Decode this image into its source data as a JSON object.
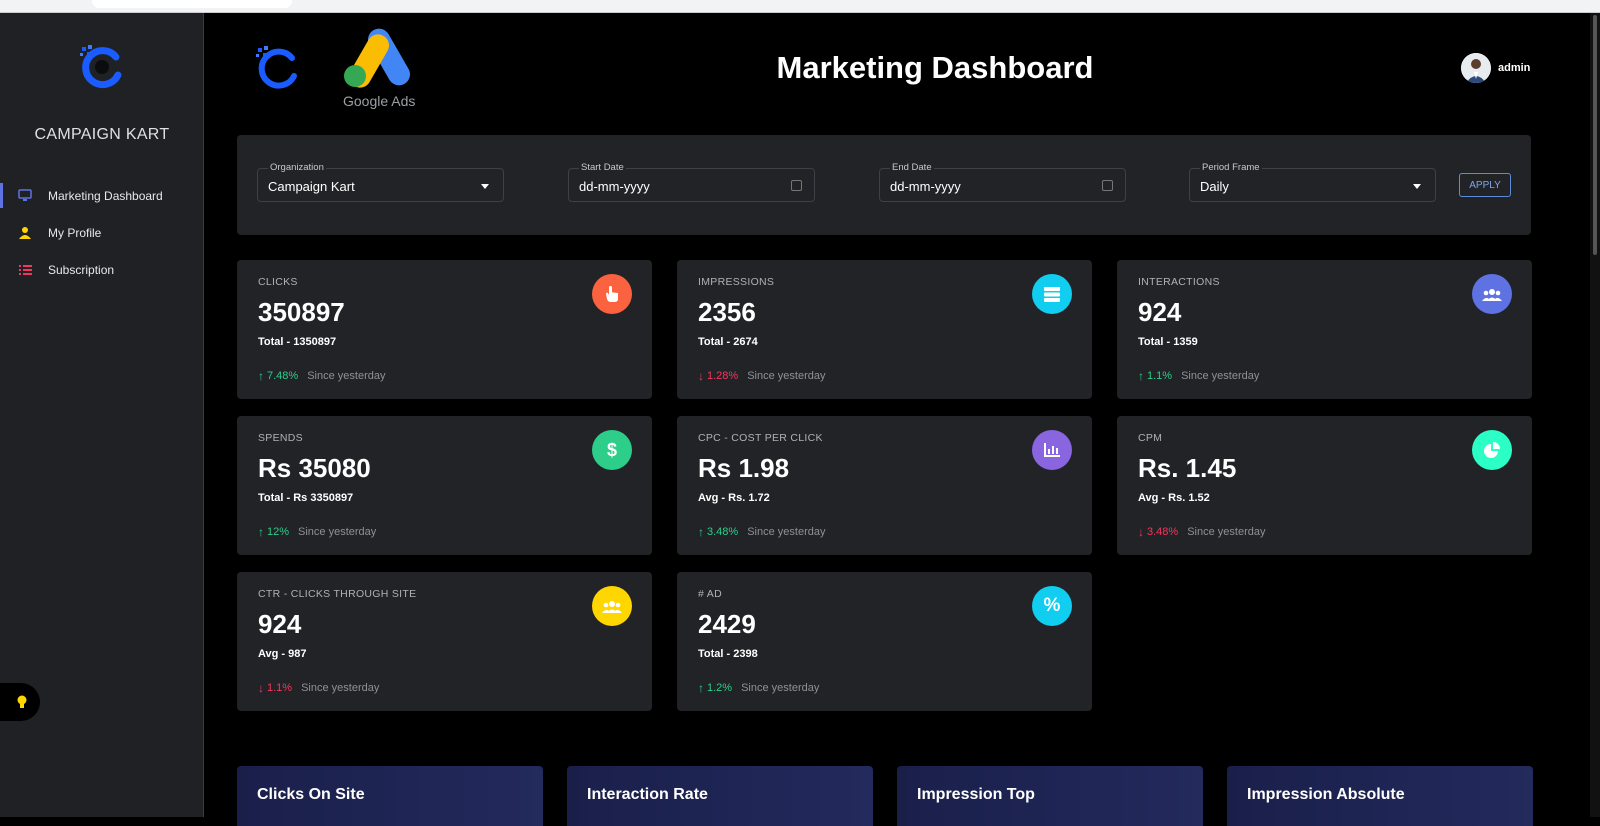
{
  "sidebar": {
    "brand": "CAMPAIGN KART",
    "items": [
      {
        "label": "Marketing Dashboard",
        "icon": "monitor-icon",
        "active": true
      },
      {
        "label": "My Profile",
        "icon": "user-icon",
        "active": false
      },
      {
        "label": "Subscription",
        "icon": "list-icon",
        "active": false
      }
    ]
  },
  "header": {
    "title": "Marketing Dashboard",
    "ads_logo_text": "Google Ads",
    "user_name": "admin"
  },
  "filters": {
    "organization": {
      "label": "Organization",
      "value": "Campaign Kart"
    },
    "start_date": {
      "label": "Start Date",
      "value": "dd-mm-yyyy"
    },
    "end_date": {
      "label": "End Date",
      "value": "dd-mm-yyyy"
    },
    "period": {
      "label": "Period Frame",
      "value": "Daily"
    },
    "apply_label": "APPLY"
  },
  "cards": [
    {
      "label": "CLICKS",
      "value": "350897",
      "sub": "Total - 1350897",
      "trend_dir": "up",
      "trend": "7.48%",
      "since": "Since yesterday",
      "icon": "hand-pointer-icon",
      "icon_color": "#fb6340"
    },
    {
      "label": "IMPRESSIONS",
      "value": "2356",
      "sub": "Total - 2674",
      "trend_dir": "down",
      "trend": "1.28%",
      "since": "Since yesterday",
      "icon": "stack-icon",
      "icon_color": "#11cdef"
    },
    {
      "label": "INTERACTIONS",
      "value": "924",
      "sub": "Total - 1359",
      "trend_dir": "up",
      "trend": "1.1%",
      "since": "Since yesterday",
      "icon": "users-icon",
      "icon_color": "#5e72e4"
    },
    {
      "label": "SPENDS",
      "value": "Rs 35080",
      "sub": "Total - Rs 3350897",
      "trend_dir": "up",
      "trend": "12%",
      "since": "Since yesterday",
      "icon": "dollar-icon",
      "icon_color": "#2dce89"
    },
    {
      "label": "CPC - COST PER CLICK",
      "value": "Rs 1.98",
      "sub": "Avg - Rs. 1.72",
      "trend_dir": "up",
      "trend": "3.48%",
      "since": "Since yesterday",
      "icon": "bar-chart-icon",
      "icon_color": "#8965e0"
    },
    {
      "label": "CPM",
      "value": "Rs. 1.45",
      "sub": "Avg - Rs. 1.52",
      "trend_dir": "down",
      "trend": "3.48%",
      "since": "Since yesterday",
      "icon": "pie-chart-icon",
      "icon_color": "#2bffc6"
    },
    {
      "label": "CTR - CLICKS THROUGH SITE",
      "value": "924",
      "sub": "Avg - 987",
      "trend_dir": "down",
      "trend": "1.1%",
      "since": "Since yesterday",
      "icon": "users-icon",
      "icon_color": "#ffd600"
    },
    {
      "label": "# AD",
      "value": "2429",
      "sub": "Total - 2398",
      "trend_dir": "up",
      "trend": "1.2%",
      "since": "Since yesterday",
      "icon": "percent-icon",
      "icon_color": "#11cdef"
    }
  ],
  "bottom_cards": [
    {
      "title": "Clicks On Site"
    },
    {
      "title": "Interaction Rate"
    },
    {
      "title": "Impression Top"
    },
    {
      "title": "Impression Absolute"
    }
  ]
}
